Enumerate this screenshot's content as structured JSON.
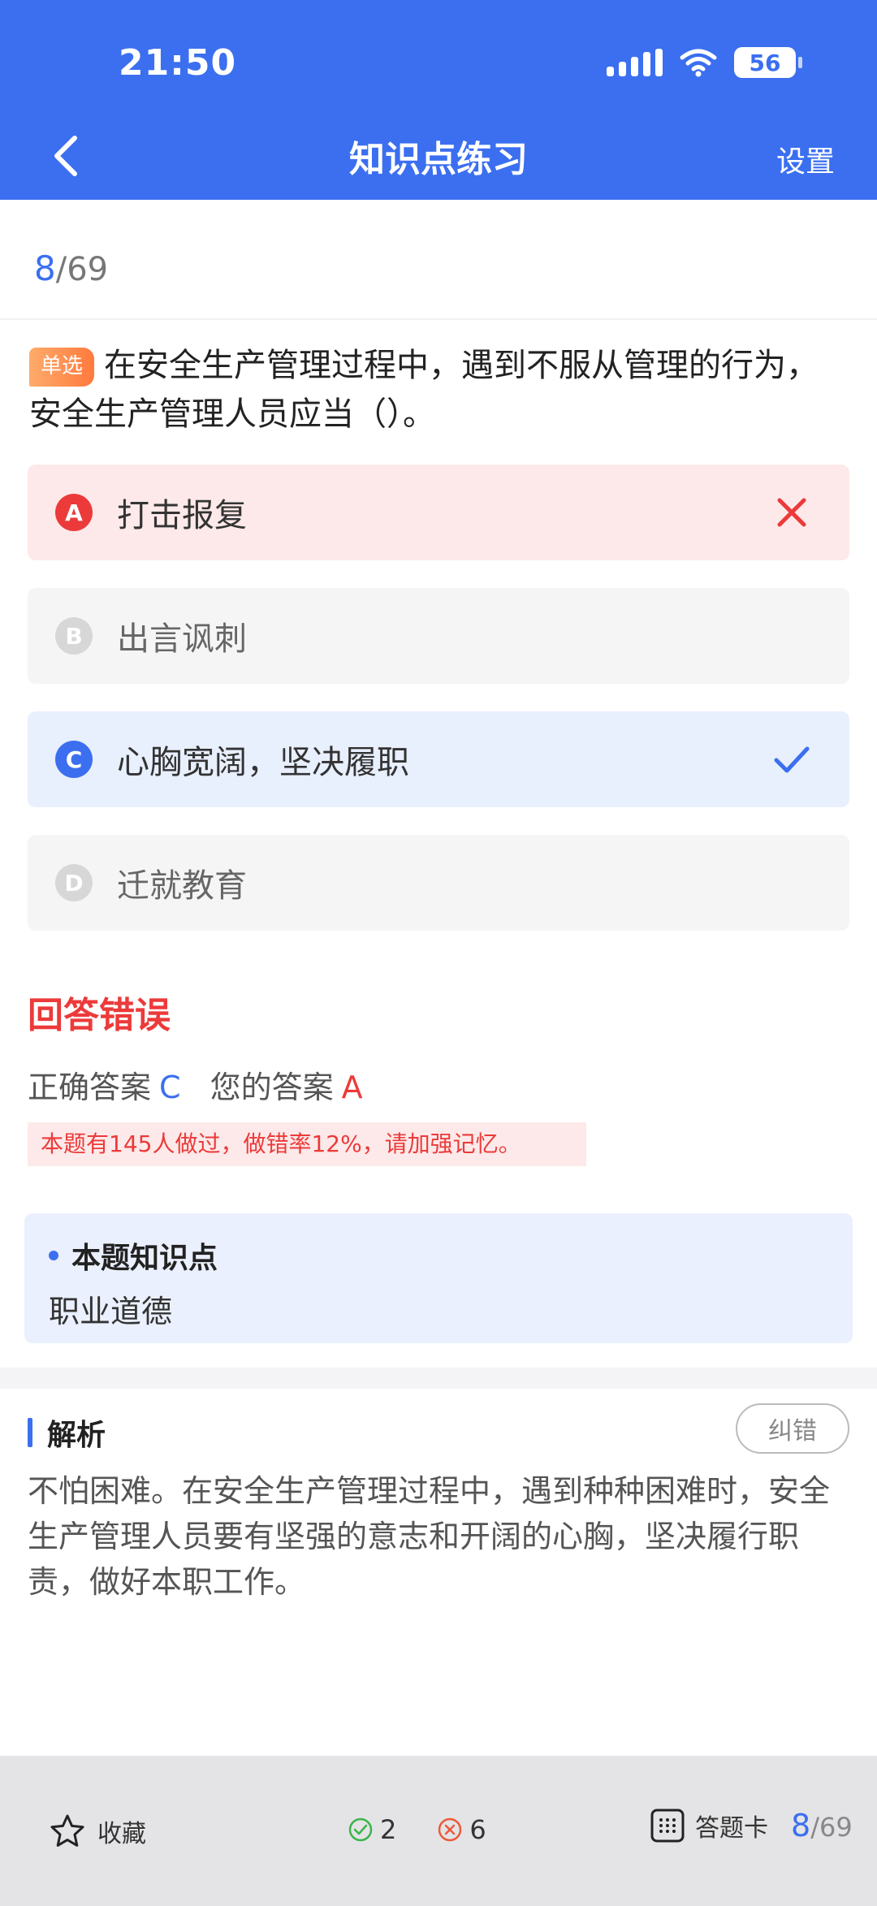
{
  "status_bar": {
    "time": "21:50",
    "battery": "56"
  },
  "nav": {
    "title": "知识点练习",
    "settings": "设置"
  },
  "progress": {
    "current": "8",
    "total": "/69"
  },
  "question": {
    "type_tag": "单选",
    "text": "在安全生产管理过程中，遇到不服从管理的行为，安全生产管理人员应当（）。"
  },
  "options": [
    {
      "letter": "A",
      "text": "打击报复",
      "state": "wrong"
    },
    {
      "letter": "B",
      "text": "出言讽刺",
      "state": "plain"
    },
    {
      "letter": "C",
      "text": "心胸宽阔，坚决履职",
      "state": "correct"
    },
    {
      "letter": "D",
      "text": "迁就教育",
      "state": "plain"
    }
  ],
  "result": {
    "title": "回答错误",
    "correct_label": "正确答案",
    "correct_value": "C",
    "your_label": "您的答案",
    "your_value": "A",
    "stat_note": "本题有145人做过，做错率12%，请加强记忆。"
  },
  "knowledge": {
    "title": "本题知识点",
    "value": "职业道德"
  },
  "analysis": {
    "title": "解析",
    "report_button": "纠错",
    "text": "不怕困难。在安全生产管理过程中，遇到种种困难时，安全生产管理人员要有坚强的意志和开阔的心胸，坚决履行职责，做好本职工作。"
  },
  "bottom_bar": {
    "favorite": "收藏",
    "right_count": "2",
    "wrong_count": "6",
    "answer_card": "答题卡",
    "page_current": "8",
    "page_total": "/69"
  },
  "colors": {
    "primary": "#3b6ff0",
    "error": "#ec3a3a",
    "tag": "#ff8a4c"
  },
  "icons": [
    "back-icon",
    "signal-icon",
    "wifi-icon",
    "battery-icon",
    "wrong-mark-icon",
    "check-mark-icon",
    "star-icon",
    "check-circle-icon",
    "cross-circle-icon",
    "grid-icon"
  ]
}
